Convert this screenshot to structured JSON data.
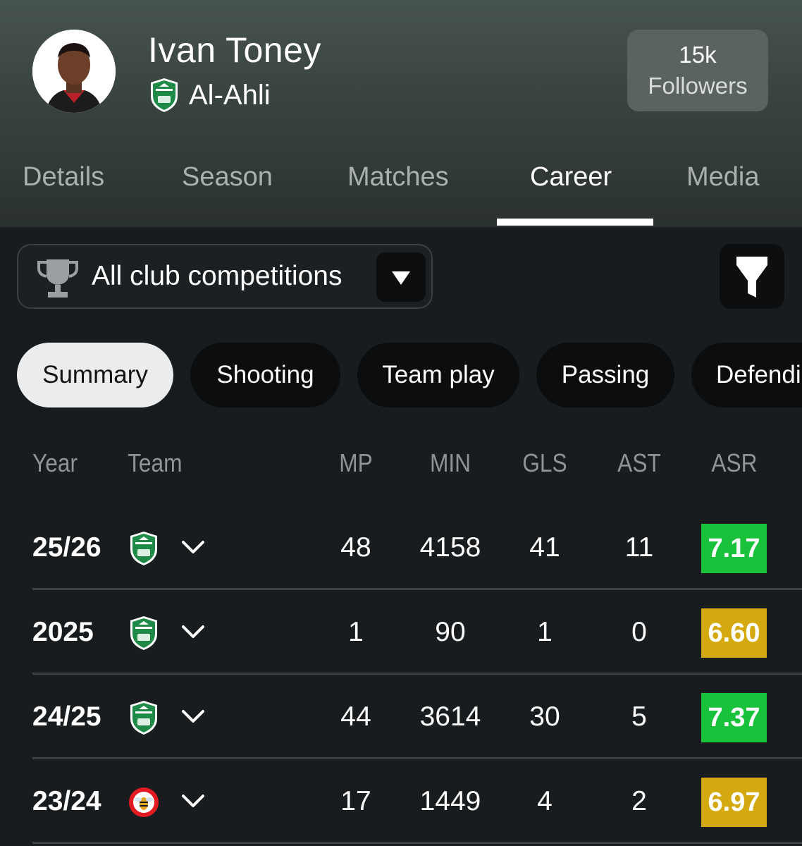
{
  "player": {
    "name": "Ivan Toney",
    "club": "Al-Ahli",
    "followers_count": "15k",
    "followers_label": "Followers"
  },
  "tabs": [
    {
      "label": "Details",
      "active": false
    },
    {
      "label": "Season",
      "active": false
    },
    {
      "label": "Matches",
      "active": false
    },
    {
      "label": "Career",
      "active": true
    },
    {
      "label": "Media",
      "active": false
    }
  ],
  "competition_filter": {
    "selected": "All club competitions",
    "icon": "trophy-icon"
  },
  "filter_button": {
    "icon": "funnel-icon"
  },
  "stat_chips": [
    {
      "label": "Summary",
      "active": true
    },
    {
      "label": "Shooting",
      "active": false
    },
    {
      "label": "Team play",
      "active": false
    },
    {
      "label": "Passing",
      "active": false
    },
    {
      "label": "Defendi",
      "active": false
    }
  ],
  "table": {
    "headers": {
      "year": "Year",
      "team": "Team",
      "mp": "MP",
      "min": "MIN",
      "gls": "GLS",
      "ast": "AST",
      "asr": "ASR"
    },
    "rows": [
      {
        "year": "25/26",
        "team": "al-ahli-crest",
        "mp": "48",
        "min": "4158",
        "gls": "41",
        "ast": "11",
        "asr": "7.17",
        "asr_color": "#19c23a"
      },
      {
        "year": "2025",
        "team": "al-ahli-crest",
        "mp": "1",
        "min": "90",
        "gls": "1",
        "ast": "0",
        "asr": "6.60",
        "asr_color": "#d4a90f"
      },
      {
        "year": "24/25",
        "team": "al-ahli-crest",
        "mp": "44",
        "min": "3614",
        "gls": "30",
        "ast": "5",
        "asr": "7.37",
        "asr_color": "#19c23a"
      },
      {
        "year": "23/24",
        "team": "brentford-crest",
        "mp": "17",
        "min": "1449",
        "gls": "4",
        "ast": "2",
        "asr": "6.97",
        "asr_color": "#d4a90f"
      }
    ]
  },
  "colors": {
    "background": "#191c1e",
    "header_gradient_top": "#47534d",
    "active_tab": "#ffffff",
    "inactive_tab": "#a9b0ad",
    "rating_green": "#19c23a",
    "rating_yellow": "#d4a90f"
  }
}
